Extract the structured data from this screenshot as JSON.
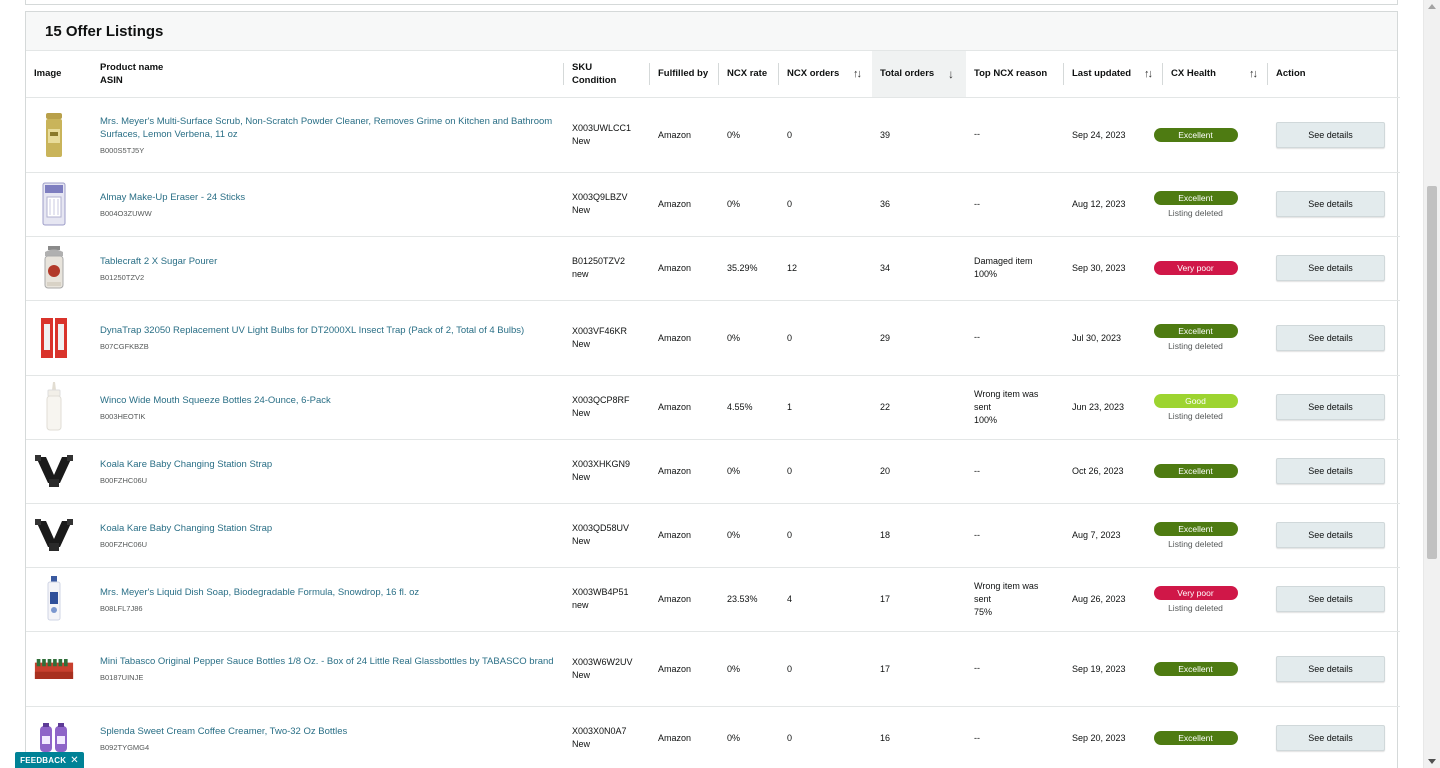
{
  "card": {
    "title": "15 Offer Listings"
  },
  "columns": {
    "image": "Image",
    "product_name": "Product name",
    "asin": "ASIN",
    "sku": "SKU",
    "condition": "Condition",
    "fulfilled_by": "Fulfilled by",
    "ncx_rate": "NCX rate",
    "ncx_orders": "NCX orders",
    "total_orders": "Total orders",
    "top_ncx_reason": "Top NCX reason",
    "last_updated": "Last updated",
    "cx_health": "CX Health",
    "action": "Action"
  },
  "rows": [
    {
      "product": "Mrs. Meyer's Multi-Surface Scrub, Non-Scratch Powder Cleaner, Removes Grime on Kitchen and Bathroom Surfaces, Lemon Verbena, 11 oz",
      "asin": "B000S5TJ5Y",
      "sku": "X003UWLCC1",
      "condition": "New",
      "fulfilled": "Amazon",
      "ncx_rate": "0%",
      "ncx_orders": "0",
      "total_orders": "39",
      "reason1": "--",
      "reason2": "",
      "reason3": "",
      "updated": "Sep 24, 2023",
      "health": "Excellent",
      "health_type": "excellent",
      "deleted": "",
      "action": "See details",
      "image": "powder-canister-image"
    },
    {
      "product": "Almay Make-Up Eraser - 24 Sticks",
      "asin": "B004O3ZUWW",
      "sku": "X003Q9LBZV",
      "condition": "New",
      "fulfilled": "Amazon",
      "ncx_rate": "0%",
      "ncx_orders": "0",
      "total_orders": "36",
      "reason1": "--",
      "reason2": "",
      "reason3": "",
      "updated": "Aug 12, 2023",
      "health": "Excellent",
      "health_type": "excellent",
      "deleted": "Listing deleted",
      "action": "See details",
      "image": "makeup-eraser-image"
    },
    {
      "product": "Tablecraft 2 X Sugar Pourer",
      "asin": "B01250TZV2",
      "sku": "B01250TZV2",
      "condition": "new",
      "fulfilled": "Amazon",
      "ncx_rate": "35.29%",
      "ncx_orders": "12",
      "total_orders": "34",
      "reason1": "Damaged item",
      "reason2": "100%",
      "reason3": "",
      "updated": "Sep 30, 2023",
      "health": "Very poor",
      "health_type": "verypoor",
      "deleted": "",
      "action": "See details",
      "image": "sugar-pourer-image"
    },
    {
      "product": "DynaTrap 32050 Replacement UV Light Bulbs for DT2000XL Insect Trap (Pack of 2, Total of 4 Bulbs)",
      "asin": "B07CGFKBZB",
      "sku": "X003VF46KR",
      "condition": "New",
      "fulfilled": "Amazon",
      "ncx_rate": "0%",
      "ncx_orders": "0",
      "total_orders": "29",
      "reason1": "--",
      "reason2": "",
      "reason3": "",
      "updated": "Jul 30, 2023",
      "health": "Excellent",
      "health_type": "excellent",
      "deleted": "Listing deleted",
      "action": "See details",
      "image": "uv-bulbs-image"
    },
    {
      "product": "Winco Wide Mouth Squeeze Bottles 24-Ounce, 6-Pack",
      "asin": "B003HEOTIK",
      "sku": "X003QCP8RF",
      "condition": "New",
      "fulfilled": "Amazon",
      "ncx_rate": "4.55%",
      "ncx_orders": "1",
      "total_orders": "22",
      "reason1": "Wrong item was",
      "reason2": "sent",
      "reason3": "100%",
      "updated": "Jun 23, 2023",
      "health": "Good",
      "health_type": "good",
      "deleted": "Listing deleted",
      "action": "See details",
      "image": "squeeze-bottle-image"
    },
    {
      "product": "Koala Kare Baby Changing Station Strap",
      "asin": "B00FZHC06U",
      "sku": "X003XHKGN9",
      "condition": "New",
      "fulfilled": "Amazon",
      "ncx_rate": "0%",
      "ncx_orders": "0",
      "total_orders": "20",
      "reason1": "--",
      "reason2": "",
      "reason3": "",
      "updated": "Oct 26, 2023",
      "health": "Excellent",
      "health_type": "excellent",
      "deleted": "",
      "action": "See details",
      "image": "strap-image"
    },
    {
      "product": "Koala Kare Baby Changing Station Strap",
      "asin": "B00FZHC06U",
      "sku": "X003QD58UV",
      "condition": "New",
      "fulfilled": "Amazon",
      "ncx_rate": "0%",
      "ncx_orders": "0",
      "total_orders": "18",
      "reason1": "--",
      "reason2": "",
      "reason3": "",
      "updated": "Aug 7, 2023",
      "health": "Excellent",
      "health_type": "excellent",
      "deleted": "Listing deleted",
      "action": "See details",
      "image": "strap-image"
    },
    {
      "product": "Mrs. Meyer's Liquid Dish Soap, Biodegradable Formula, Snowdrop, 16 fl. oz",
      "asin": "B08LFL7J86",
      "sku": "X003WB4P51",
      "condition": "new",
      "fulfilled": "Amazon",
      "ncx_rate": "23.53%",
      "ncx_orders": "4",
      "total_orders": "17",
      "reason1": "Wrong item was",
      "reason2": "sent",
      "reason3": "75%",
      "updated": "Aug 26, 2023",
      "health": "Very poor",
      "health_type": "verypoor",
      "deleted": "Listing deleted",
      "action": "See details",
      "image": "dish-soap-image"
    },
    {
      "product": "Mini Tabasco Original Pepper Sauce Bottles 1/8 Oz. - Box of 24 Little Real Glassbottles by TABASCO brand",
      "asin": "B0187UINJE",
      "sku": "X003W6W2UV",
      "condition": "New",
      "fulfilled": "Amazon",
      "ncx_rate": "0%",
      "ncx_orders": "0",
      "total_orders": "17",
      "reason1": "--",
      "reason2": "",
      "reason3": "",
      "updated": "Sep 19, 2023",
      "health": "Excellent",
      "health_type": "excellent",
      "deleted": "",
      "action": "See details",
      "image": "tabasco-box-image"
    },
    {
      "product": "Splenda Sweet Cream Coffee Creamer, Two-32 Oz Bottles",
      "asin": "B092TYGMG4",
      "sku": "X003X0N0A7",
      "condition": "New",
      "fulfilled": "Amazon",
      "ncx_rate": "0%",
      "ncx_orders": "0",
      "total_orders": "16",
      "reason1": "--",
      "reason2": "",
      "reason3": "",
      "updated": "Sep 20, 2023",
      "health": "Excellent",
      "health_type": "excellent",
      "deleted": "",
      "action": "See details",
      "image": "creamer-bottles-image"
    }
  ],
  "feedback": {
    "label": "FEEDBACK",
    "close": "✕"
  },
  "colors": {
    "link": "#2a6f86",
    "excellent": "#4e7b12",
    "good": "#9dd430",
    "very_poor": "#d01748",
    "button": "#e3ebed",
    "feedback": "#008296"
  }
}
